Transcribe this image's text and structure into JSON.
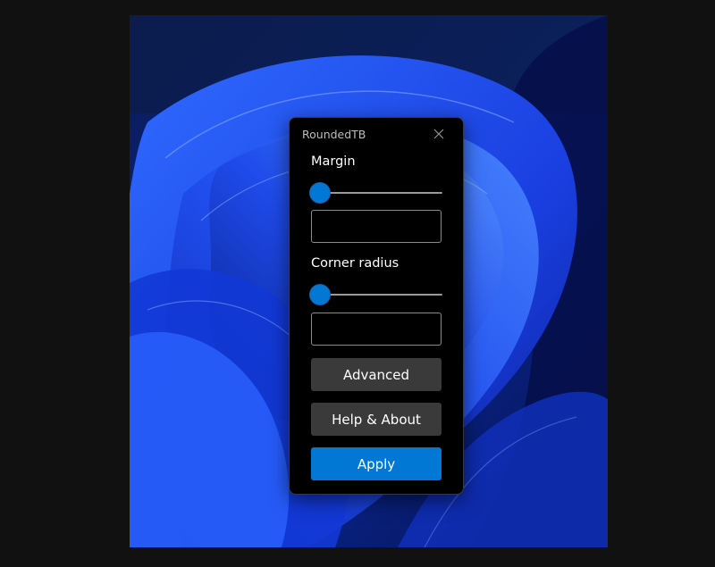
{
  "window": {
    "title": "RoundedTB",
    "close_icon": "close-icon"
  },
  "margin": {
    "label": "Margin",
    "slider_value_fraction": 0.0,
    "input_value": ""
  },
  "corner_radius": {
    "label": "Corner radius",
    "slider_value_fraction": 0.0,
    "input_value": ""
  },
  "buttons": {
    "advanced": "Advanced",
    "help_about": "Help & About",
    "apply": "Apply"
  },
  "colors": {
    "accent": "#0078d4",
    "window_bg": "#000000",
    "secondary_button": "#3a3a3a",
    "desktop_bg": "#111111"
  }
}
